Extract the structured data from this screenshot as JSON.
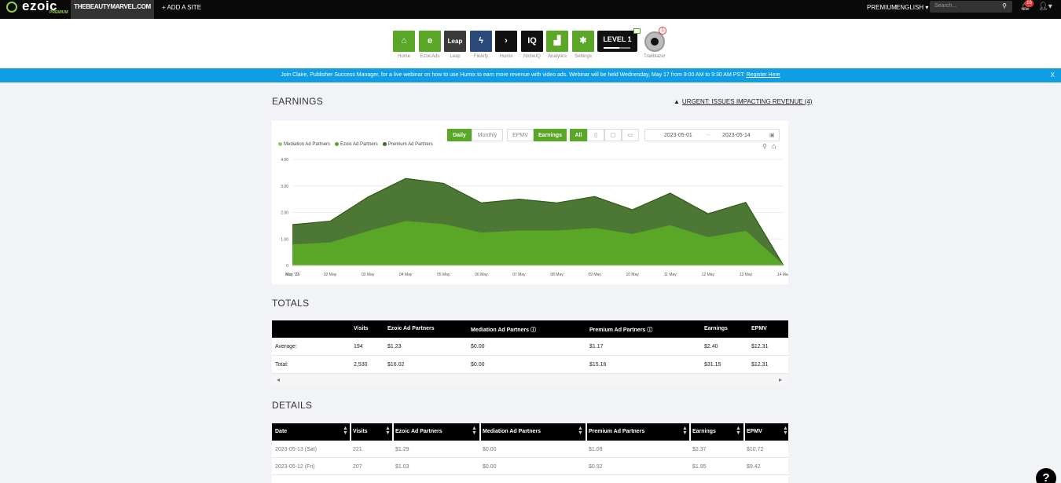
{
  "topbar": {
    "logo": "ezoic",
    "logo_sub": "PREMIUM",
    "site": "THEBEAUTYMARVEL.COM",
    "add_site": "+ ADD A SITE",
    "premium": "PREMIUM",
    "language": "ENGLISH",
    "search_placeholder": "Search...",
    "notifications": "16"
  },
  "apps": [
    {
      "label": "Home",
      "glyph": "⌂",
      "color": "#5aa626"
    },
    {
      "label": "EzoicAds",
      "glyph": "e",
      "color": "#5aa626"
    },
    {
      "label": "Leap",
      "glyph": "Leap",
      "color": "#3a3a3a"
    },
    {
      "label": "Flickify",
      "glyph": "ϟ",
      "color": "#2b4a7a"
    },
    {
      "label": "Humix",
      "glyph": "›",
      "color": "#111"
    },
    {
      "label": "NicheIQ",
      "glyph": "IQ",
      "color": "#111"
    },
    {
      "label": "Analytics",
      "glyph": "▟",
      "color": "#5aa626"
    },
    {
      "label": "Settings",
      "glyph": "✱",
      "color": "#5aa626"
    }
  ],
  "level_badge": "LEVEL 1",
  "trailblazer": {
    "label": "Trailblazer",
    "count": "1"
  },
  "banner": {
    "text": "Join Claire, Publisher Success Manager, for a live webinar on how to use Humix to earn more revenue with video ads. Webinar will be held Wednesday, May 17 from 9:00 AM to 9:30 AM PST:",
    "link": "Register Here",
    "close": "X"
  },
  "earnings": {
    "title": "EARNINGS",
    "urgent": "URGENT: ISSUES IMPACTING REVENUE (4)",
    "toggles": {
      "daily": "Daily",
      "monthly": "Monthly",
      "epmv": "EPMV",
      "earnings": "Earnings",
      "all": "All"
    },
    "date_from": "2023-05-01",
    "date_sep": "--",
    "date_to": "2023-05-14"
  },
  "chart_data": {
    "type": "area",
    "categories": [
      "May '23",
      "02 May",
      "03 May",
      "04 May",
      "05 May",
      "06 May",
      "07 May",
      "08 May",
      "09 May",
      "10 May",
      "11 May",
      "12 May",
      "13 May",
      "14 May"
    ],
    "y_ticks": [
      "0",
      "1.00",
      "2.00",
      "3.00",
      "4.00"
    ],
    "ylim": [
      0,
      4
    ],
    "stacked": true,
    "series": [
      {
        "name": "Mediation Ad Partners",
        "color": "#9ccc65",
        "values": [
          0,
          0,
          0,
          0,
          0,
          0,
          0,
          0,
          0,
          0,
          0,
          0,
          0,
          0
        ]
      },
      {
        "name": "Ezoic Ad Partners",
        "color": "#5aa626",
        "values": [
          0.78,
          0.85,
          1.28,
          1.66,
          1.55,
          1.22,
          1.3,
          1.3,
          1.4,
          1.17,
          1.5,
          1.05,
          1.29,
          0
        ]
      },
      {
        "name": "Premium Ad Partners",
        "color": "#3e6b23",
        "values": [
          0.76,
          0.82,
          1.3,
          1.62,
          1.55,
          1.14,
          1.2,
          1.06,
          1.2,
          0.93,
          1.23,
          0.9,
          1.09,
          0
        ]
      }
    ]
  },
  "totals": {
    "title": "TOTALS",
    "headers": [
      "Visits",
      "Ezoic Ad Partners",
      "Mediation Ad Partners",
      "Premium Ad Partners",
      "Earnings",
      "EPMV"
    ],
    "rows": [
      {
        "label": "Average:",
        "cells": [
          "194",
          "$1.23",
          "$0.00",
          "$1.17",
          "$2.40",
          "$12.31"
        ]
      },
      {
        "label": "Total:",
        "cells": [
          "2,530",
          "$16.02",
          "$0.00",
          "$15.16",
          "$31.15",
          "$12.31"
        ]
      }
    ]
  },
  "details": {
    "title": "DETAILS",
    "headers": [
      "Date",
      "Visits",
      "Ezoic Ad Partners",
      "Mediation Ad Partners",
      "Premium Ad Partners",
      "Earnings",
      "EPMV"
    ],
    "rows": [
      [
        "2023-05-13 (Sat)",
        "221",
        "$1.29",
        "$0.00",
        "$1.09",
        "$2.37",
        "$10.72"
      ],
      [
        "2023-05-12 (Fri)",
        "207",
        "$1.03",
        "$0.00",
        "$0.92",
        "$1.95",
        "$9.42"
      ]
    ]
  },
  "help": "?"
}
